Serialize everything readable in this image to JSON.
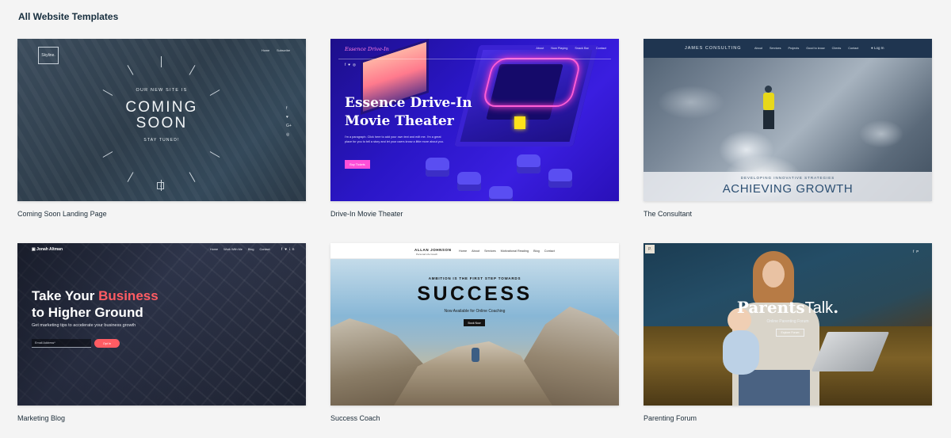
{
  "page": {
    "heading": "All Website Templates"
  },
  "templates": [
    {
      "label": "Coming Soon Landing Page",
      "content": {
        "logo": "Skyline.",
        "nav": [
          "Home",
          "Subscribe"
        ],
        "kicker": "OUR NEW SITE IS",
        "headline_line1": "COMING",
        "headline_line2": "SOON",
        "tagline": "STAY TUNED!",
        "social_icons": [
          "facebook-icon",
          "twitter-icon",
          "google-plus-icon",
          "instagram-icon"
        ]
      }
    },
    {
      "label": "Drive-In Movie Theater",
      "content": {
        "brand": "Essence Drive-In",
        "nav": [
          "About",
          "Now Playing",
          "Snack Bar",
          "Contact"
        ],
        "headline_line1": "Essence Drive-In",
        "headline_line2": "Movie Theater",
        "paragraph": "I'm a paragraph. Click here to add your own text and edit me. I'm a great place for you to tell a story and let your users know a little more about you.",
        "button": "Buy Tickets"
      }
    },
    {
      "label": "The Consultant",
      "content": {
        "brand": "JAMES CONSULTING",
        "nav": [
          "About",
          "Services",
          "Projects",
          "Good to know",
          "Clients",
          "Contact"
        ],
        "login": "Log In",
        "kicker": "DEVELOPING INNOVATIVE STRATEGIES",
        "headline": "ACHIEVING GROWTH"
      }
    },
    {
      "label": "Marketing Blog",
      "content": {
        "brand": "Jonah Altman",
        "nav": [
          "Home",
          "Work With Me",
          "Blog",
          "Contact"
        ],
        "headline_part1": "Take Your ",
        "headline_accent": "Business",
        "headline_part2": "to Higher Ground",
        "subtitle": "Get marketing tips to accelerate your business growth",
        "email_placeholder": "Email Address*",
        "button": "Opt In"
      }
    },
    {
      "label": "Success Coach",
      "content": {
        "brand": "ALLAN JOHNSON",
        "brand_sub": "Personal Life Coach",
        "nav": [
          "Home",
          "About",
          "Services",
          "Motivational Reading",
          "Blog",
          "Contact"
        ],
        "kicker": "AMBITION IS THE FIRST STEP TOWARDS",
        "headline": "SUCCESS",
        "subtitle": "Now Available for Online Coaching",
        "button": "Book Now"
      }
    },
    {
      "label": "Parenting Forum",
      "content": {
        "badge": "P.",
        "wordmark_bold": "Parents",
        "wordmark_light": "Talk",
        "wordmark_dot": ".",
        "subtitle": "Online Parenting Forum",
        "button": "Explore Forum"
      }
    }
  ],
  "colors": {
    "page_bg": "#f4f4f4",
    "heading": "#162d3d",
    "driveIn_accent": "#ff4fd8",
    "marketing_accent": "#ff5c63",
    "consultant_navy": "#1f3550"
  }
}
